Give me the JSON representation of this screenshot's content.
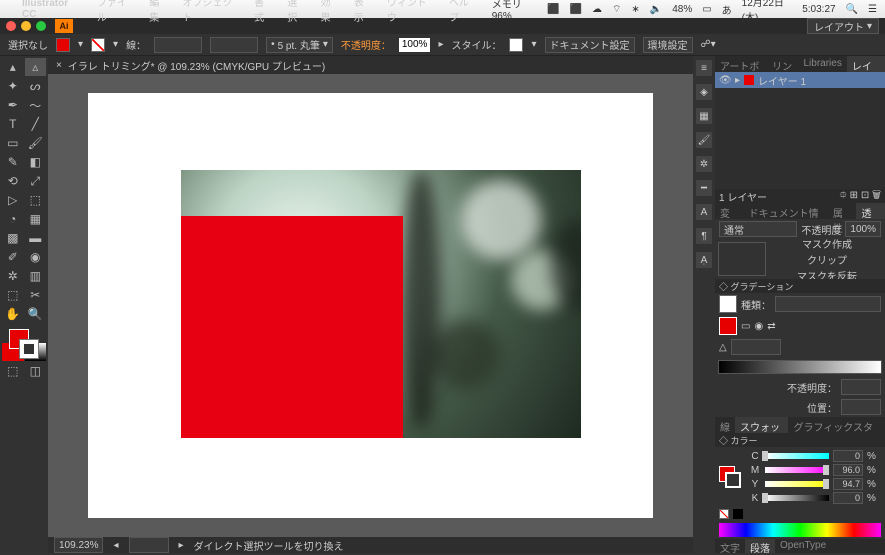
{
  "menubar": {
    "app": "Illustrator CC",
    "items": [
      "ファイル",
      "編集",
      "オブジェクト",
      "書式",
      "選択",
      "効果",
      "表示",
      "ウィンドウ",
      "ヘルプ"
    ],
    "memory": "メモリ 96%",
    "battery": "48%",
    "date": "12月22日(木)",
    "time": "5:03:27"
  },
  "chrome": {
    "layout": "レイアウト"
  },
  "control": {
    "selection": "選択なし",
    "stroke_label": "線：",
    "stroke_weight": "5 pt. 丸筆",
    "opacity_label": "不透明度：",
    "opacity": "100%",
    "style_label": "スタイル：",
    "doc_setup": "ドキュメント設定",
    "prefs": "環境設定"
  },
  "tab": {
    "name": "イラレ トリミング* @ 109.23% (CMYK/GPU プレビュー)"
  },
  "status": {
    "zoom": "109.23%",
    "tool": "ダイレクト選択ツールを切り換え"
  },
  "layers_panel": {
    "tabs": [
      "アートボード",
      "リンク",
      "Libraries",
      "レイヤー"
    ],
    "layer_name": "レイヤー 1",
    "count": "1 レイヤー"
  },
  "transp_panel": {
    "tabs": [
      "変形",
      "ドキュメント情報",
      "属性",
      "透明"
    ],
    "blend": "通常",
    "op_label": "不透明度",
    "op": "100%",
    "mask_make": "マスク作成",
    "clip": "クリップ",
    "invert": "マスクを反転"
  },
  "grad_panel": {
    "title": "◇ グラデーション",
    "type_label": "種類：",
    "op_label": "不透明度：",
    "pos_label": "位置："
  },
  "swatch_panel": {
    "tabs": [
      "線",
      "スウォッチ",
      "グラフィックスタイル"
    ]
  },
  "color_panel": {
    "title": "◇ カラー",
    "c": {
      "l": "C",
      "v": "0"
    },
    "m": {
      "l": "M",
      "v": "96.0"
    },
    "y": {
      "l": "Y",
      "v": "94.7"
    },
    "k": {
      "l": "K",
      "v": "0"
    },
    "pct": "%"
  },
  "bottom_tabs": {
    "items": [
      "文字",
      "段落",
      "OpenType"
    ]
  }
}
